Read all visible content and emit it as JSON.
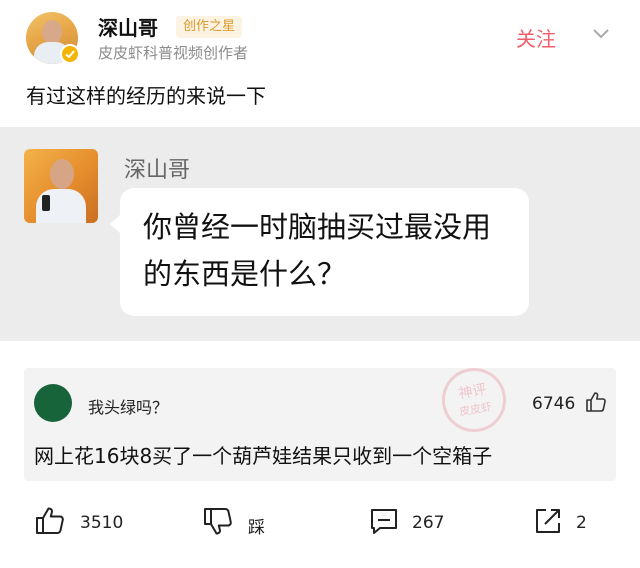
{
  "author": {
    "name": "深山哥",
    "badge": "创作之星",
    "subtitle": "皮皮虾科普视频创作者",
    "follow_label": "关注"
  },
  "post": {
    "text": "有过这样的经历的来说一下"
  },
  "quoted_card": {
    "name": "深山哥",
    "bubble_line1": "你曾经一时脑抽买过最没用",
    "bubble_line2": "的东西是什么？"
  },
  "comment": {
    "username": "我头绿吗？",
    "likes": "6746",
    "text": "网上花16块8买了一个葫芦娃结果只收到一个空箱子",
    "stamp_line1": "神评",
    "stamp_line2": "皮皮虾"
  },
  "actions": {
    "like_count": "3510",
    "dislike_label": "踩",
    "comment_count": "267",
    "share_count": "2"
  },
  "colors": {
    "follow": "#ef5f6c",
    "badge_text": "#d99a2b",
    "badge_bg": "#fdf3e2",
    "card_bg": "#ececec",
    "comment_bg": "#f3f3f3",
    "comment_avatar": "#17633a"
  }
}
